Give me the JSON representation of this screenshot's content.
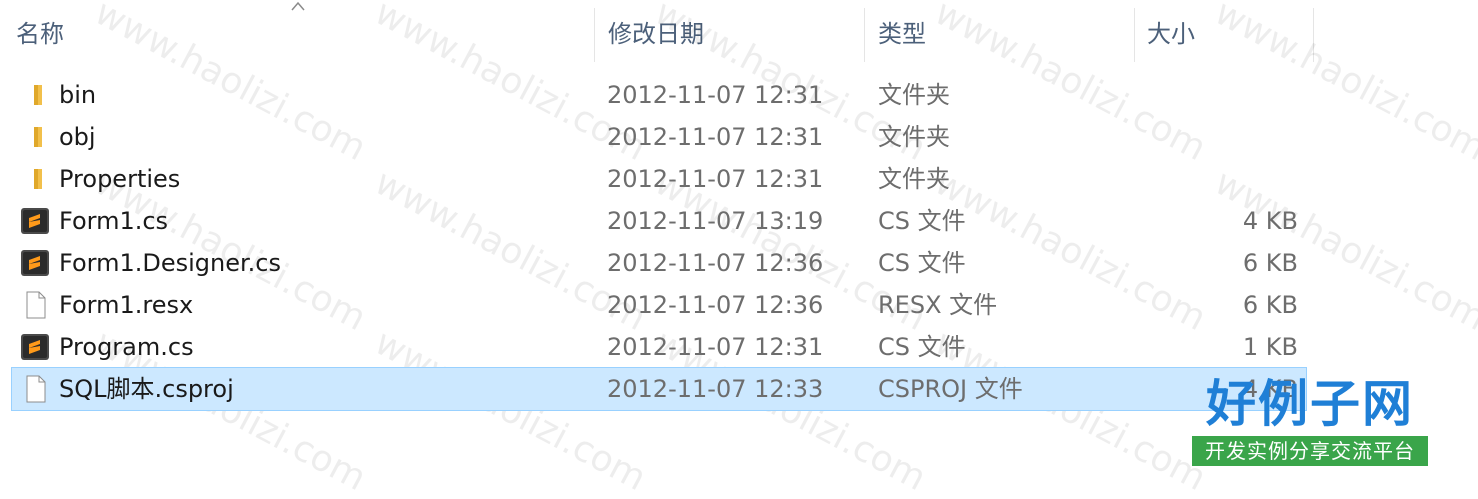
{
  "columns": {
    "name": "名称",
    "date": "修改日期",
    "type": "类型",
    "size": "大小"
  },
  "files": [
    {
      "name": "bin",
      "date": "2012-11-07 12:31",
      "type": "文件夹",
      "size": "",
      "icon": "folder-icon"
    },
    {
      "name": "obj",
      "date": "2012-11-07 12:31",
      "type": "文件夹",
      "size": "",
      "icon": "folder-icon"
    },
    {
      "name": "Properties",
      "date": "2012-11-07 12:31",
      "type": "文件夹",
      "size": "",
      "icon": "folder-icon"
    },
    {
      "name": "Form1.cs",
      "date": "2012-11-07 13:19",
      "type": "CS 文件",
      "size": "4 KB",
      "icon": "sublime-file-icon"
    },
    {
      "name": "Form1.Designer.cs",
      "date": "2012-11-07 12:36",
      "type": "CS 文件",
      "size": "6 KB",
      "icon": "sublime-file-icon"
    },
    {
      "name": "Form1.resx",
      "date": "2012-11-07 12:36",
      "type": "RESX 文件",
      "size": "6 KB",
      "icon": "blank-file-icon"
    },
    {
      "name": "Program.cs",
      "date": "2012-11-07 12:31",
      "type": "CS 文件",
      "size": "1 KB",
      "icon": "sublime-file-icon"
    },
    {
      "name": "SQL脚本.csproj",
      "date": "2012-11-07 12:33",
      "type": "CSPROJ 文件",
      "size": "4 KB",
      "icon": "blank-file-icon",
      "selected": true
    }
  ],
  "watermark": "www.haolizi.com",
  "logo": {
    "main": "好例子网",
    "sub": "开发实例分享交流平台"
  },
  "colors": {
    "selection": "#cce8ff",
    "header_text": "#4c607a",
    "folder": "#f2c04b",
    "logo_blue": "#1f7fd6",
    "logo_green": "#3aa54a"
  }
}
